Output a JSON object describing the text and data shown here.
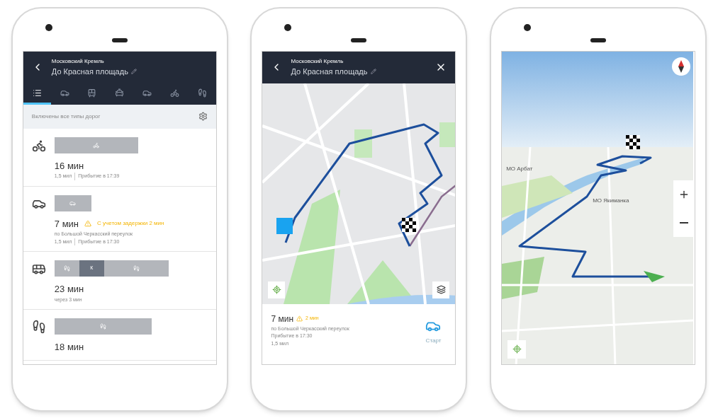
{
  "route_list_screen": {
    "header": {
      "subtitle": "Московский Кремль",
      "title": "До Красная площадь"
    },
    "tabs": [
      {
        "kind": "all",
        "selected": true
      },
      {
        "kind": "car",
        "selected": false
      },
      {
        "kind": "transit",
        "selected": false
      },
      {
        "kind": "taxi",
        "selected": false
      },
      {
        "kind": "carshare",
        "selected": false
      },
      {
        "kind": "bike",
        "selected": false
      },
      {
        "kind": "walk",
        "selected": false
      }
    ],
    "filter": "Включены все типы дорог",
    "routes": [
      {
        "kind": "bike",
        "segments": [
          {
            "kind": "bike"
          }
        ],
        "time": "16 мин",
        "distance": "1,5 мил",
        "arrival": "Прибытие в 17:39"
      },
      {
        "kind": "car",
        "segments": [
          {
            "kind": "car"
          }
        ],
        "time": "7 мин",
        "warning": "С учетом задержки 2 мин",
        "via": "по Большой Черкасский переулок",
        "distance": "1,5 мил",
        "arrival": "Прибытие в 17:30"
      },
      {
        "kind": "bus",
        "segments": [
          {
            "kind": "walk"
          },
          {
            "kind": "transit",
            "label": "К"
          },
          {
            "kind": "walk"
          }
        ],
        "time": "23 мин",
        "note": "через 3 мин"
      },
      {
        "kind": "walk",
        "segments": [
          {
            "kind": "walk"
          }
        ],
        "time": "18 мин"
      }
    ]
  },
  "map_screen": {
    "header": {
      "subtitle": "Московский Кремль",
      "title": "До Красная площадь"
    },
    "card": {
      "time": "7 мин",
      "warning": "2 мин",
      "via": "по Большой Черкасский переулок",
      "arrival": "Прибытие в 17:30",
      "distance": "1,5 мил",
      "start_button": "Старт"
    }
  },
  "map_3d_screen": {
    "labels": [
      "МО Арбат",
      "МО Якиманка"
    ]
  }
}
